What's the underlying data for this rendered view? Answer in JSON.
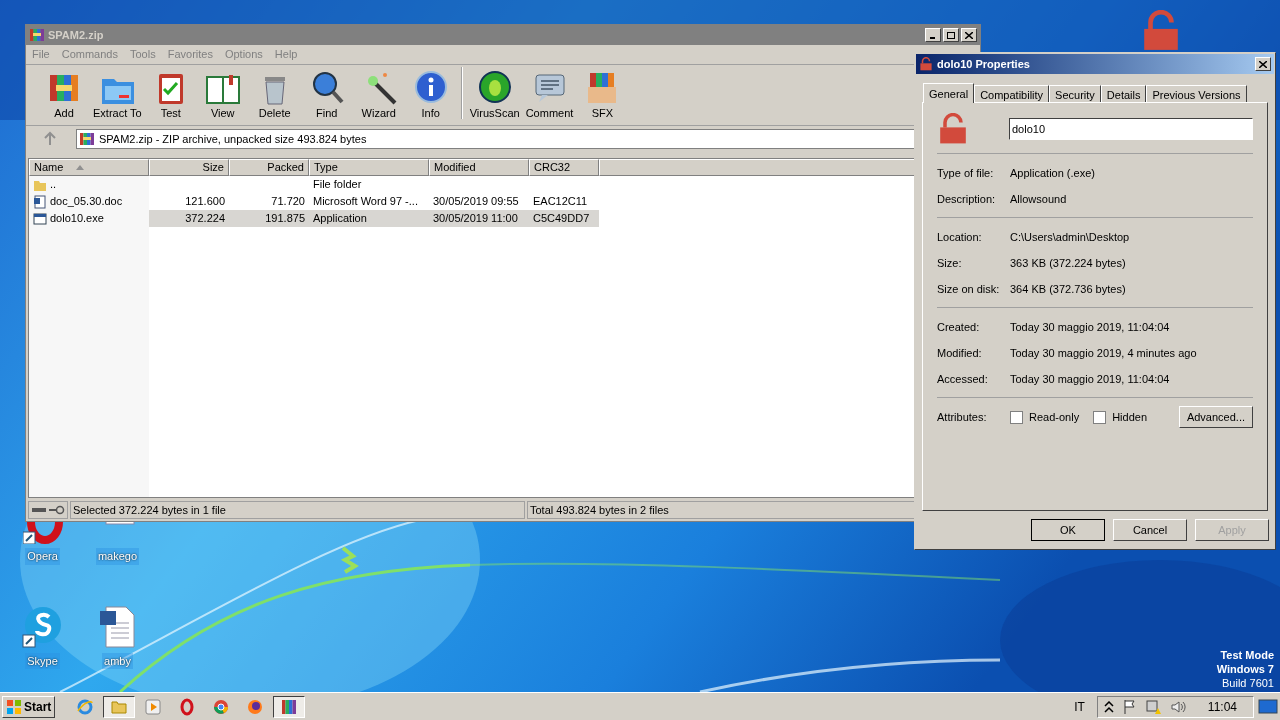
{
  "desktop_icons": [
    {
      "label": "Opera",
      "kind": "opera"
    },
    {
      "label": "makego",
      "kind": "doc"
    },
    {
      "label": "Skype",
      "kind": "skype"
    },
    {
      "label": "amby",
      "kind": "word"
    }
  ],
  "winrar": {
    "title": "SPAM2.zip",
    "menu": [
      "File",
      "Commands",
      "Tools",
      "Favorites",
      "Options",
      "Help"
    ],
    "toolbar": [
      {
        "label": "Add",
        "kind": "add"
      },
      {
        "label": "Extract To",
        "kind": "extract"
      },
      {
        "label": "Test",
        "kind": "test"
      },
      {
        "label": "View",
        "kind": "view"
      },
      {
        "label": "Delete",
        "kind": "delete"
      },
      {
        "label": "Find",
        "kind": "find"
      },
      {
        "label": "Wizard",
        "kind": "wizard"
      },
      {
        "label": "Info",
        "kind": "info"
      },
      {
        "label": "VirusScan",
        "kind": "virus"
      },
      {
        "label": "Comment",
        "kind": "comment"
      },
      {
        "label": "SFX",
        "kind": "sfx"
      }
    ],
    "address": "SPAM2.zip - ZIP archive, unpacked size 493.824 bytes",
    "columns": [
      "Name",
      "Size",
      "Packed",
      "Type",
      "Modified",
      "CRC32"
    ],
    "rows": [
      {
        "kind": "folder",
        "selected": false,
        "cells": [
          "..",
          "",
          "",
          "File folder",
          "",
          ""
        ]
      },
      {
        "kind": "doc",
        "selected": false,
        "cells": [
          "doc_05.30.doc",
          "121.600",
          "71.720",
          "Microsoft Word 97 -...",
          "30/05/2019 09:55",
          "EAC12C11"
        ]
      },
      {
        "kind": "exe",
        "selected": true,
        "cells": [
          "dolo10.exe",
          "372.224",
          "191.875",
          "Application",
          "30/05/2019 11:00",
          "C5C49DD7"
        ]
      }
    ],
    "status_left": "Selected 372.224 bytes in 1 file",
    "status_right": "Total 493.824 bytes in 2 files"
  },
  "properties": {
    "title": "dolo10 Properties",
    "tabs": [
      {
        "label": "General",
        "selected": true
      },
      {
        "label": "Compatibility",
        "selected": false
      },
      {
        "label": "Security",
        "selected": false
      },
      {
        "label": "Details",
        "selected": false
      },
      {
        "label": "Previous Versions",
        "selected": false
      }
    ],
    "name": "dolo10",
    "groups": [
      [
        {
          "label": "Type of file:",
          "value": "Application (.exe)"
        },
        {
          "label": "Description:",
          "value": "Allowsound"
        }
      ],
      [
        {
          "label": "Location:",
          "value": "C:\\Users\\admin\\Desktop"
        },
        {
          "label": "Size:",
          "value": "363 KB (372.224 bytes)"
        },
        {
          "label": "Size on disk:",
          "value": "364 KB (372.736 bytes)"
        }
      ],
      [
        {
          "label": "Created:",
          "value": "Today 30 maggio 2019, 11:04:04"
        },
        {
          "label": "Modified:",
          "value": "Today 30 maggio 2019, 4 minutes ago"
        },
        {
          "label": "Accessed:",
          "value": "Today 30 maggio 2019, 11:04:04"
        }
      ]
    ],
    "attributes_label": "Attributes:",
    "attributes": [
      {
        "label": "Read-only",
        "checked": false
      },
      {
        "label": "Hidden",
        "checked": false
      }
    ],
    "advanced": "Advanced...",
    "buttons": [
      {
        "label": "OK",
        "disabled": false
      },
      {
        "label": "Cancel",
        "disabled": false
      },
      {
        "label": "Apply",
        "disabled": true
      }
    ]
  },
  "watermark_text": [
    "Test Mode",
    "Windows 7",
    "Build 7601"
  ],
  "taskbar": {
    "start": "Start",
    "apps": [
      {
        "kind": "ie",
        "selected": false
      },
      {
        "kind": "explorer",
        "selected": true
      },
      {
        "kind": "media",
        "selected": false
      },
      {
        "kind": "opera",
        "selected": false
      },
      {
        "kind": "chrome",
        "selected": false
      },
      {
        "kind": "firefox",
        "selected": false
      },
      {
        "kind": "winrar",
        "selected": true
      }
    ],
    "language": "IT",
    "clock": "11:04"
  }
}
